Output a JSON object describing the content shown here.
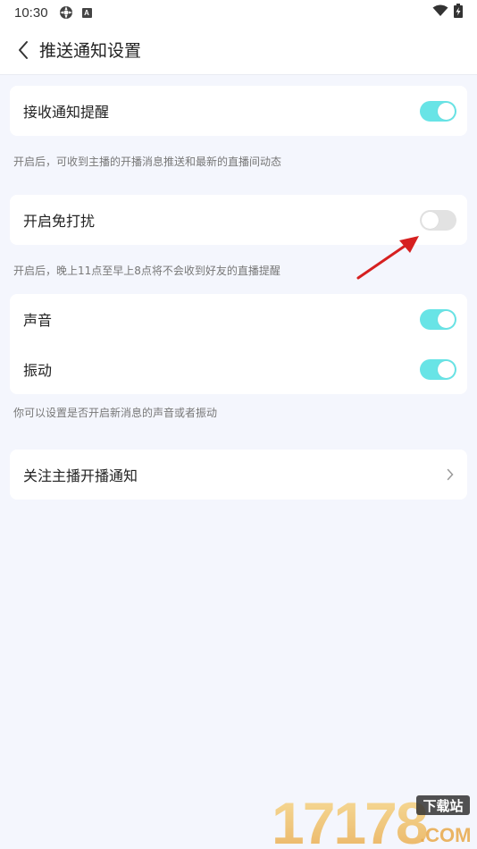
{
  "status_bar": {
    "time": "10:30",
    "icons": [
      "settings-gear-icon",
      "accessibility-a-icon"
    ],
    "right_icons": [
      "wifi-icon",
      "battery-charging-icon"
    ],
    "badge_letter": "A"
  },
  "header": {
    "title": "推送通知设置",
    "back_icon": "chevron-left-icon"
  },
  "sections": {
    "receive": {
      "label": "接收通知提醒",
      "toggle_on": true
    },
    "receive_hint": "开启后，可收到主播的开播消息推送和最新的直播间动态",
    "dnd": {
      "label": "开启免打扰",
      "toggle_on": false
    },
    "dnd_hint": "开启后，晚上11点至早上8点将不会收到好友的直播提醒",
    "sound": {
      "label": "声音",
      "toggle_on": true
    },
    "vibrate": {
      "label": "振动",
      "toggle_on": true
    },
    "sound_hint": "你可以设置是否开启新消息的声音或者振动",
    "follow": {
      "label": "关注主播开播通知",
      "icon": "chevron-right-icon"
    }
  },
  "watermark": {
    "brand": "17178",
    "badge": "下载站",
    "domain": ".COM"
  },
  "colors": {
    "toggle_on": "#68e4e6",
    "toggle_off": "#e2e2e2",
    "background": "#f4f6fd",
    "annotation_arrow": "#d62020"
  }
}
